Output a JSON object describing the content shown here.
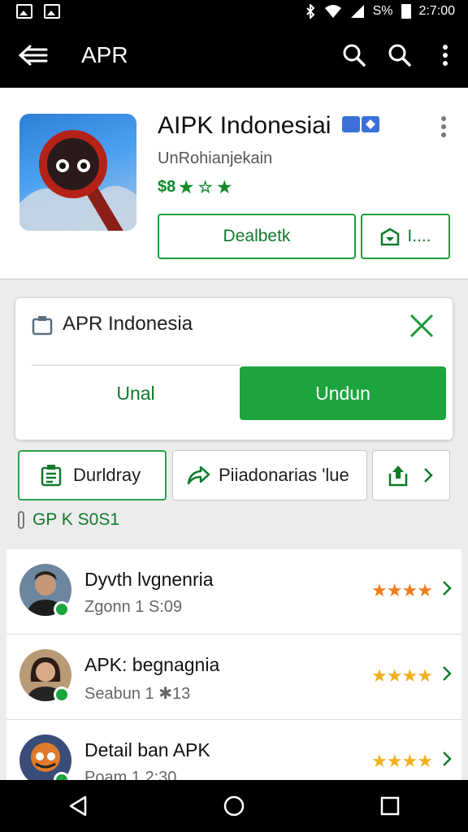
{
  "status_bar": {
    "battery": "S%",
    "time": "2:7:00"
  },
  "app_bar": {
    "title": "APR"
  },
  "app_header": {
    "name": "AIPK Indonesiai",
    "developer": "UnRohianjekain",
    "price": "$8",
    "stars": "★ ☆ ★",
    "primary_button": "Dealbetk",
    "secondary_button": "I...."
  },
  "dialog": {
    "title": "APR Indonesia",
    "left_button": "Unal",
    "right_button": "Undun"
  },
  "chips": {
    "chip1": "Durldray",
    "chip2": "Piiadonarias 'lue"
  },
  "section_title": "GP K S0S1",
  "list": [
    {
      "title": "Dyvth lvgnenria",
      "subtitle": "Zgonn 1 S:09",
      "stars": "★★★★"
    },
    {
      "title": "APK: begnagnia",
      "subtitle": "Seabun 1 ✱13",
      "stars": "★★★★"
    },
    {
      "title": "Detail ban APK",
      "subtitle": "Poam 1 2:30",
      "stars": "★★★★"
    }
  ],
  "colors": {
    "accent": "#1ca43e",
    "star_orange": "#f07c1e",
    "star_yellow": "#f2b01e"
  }
}
